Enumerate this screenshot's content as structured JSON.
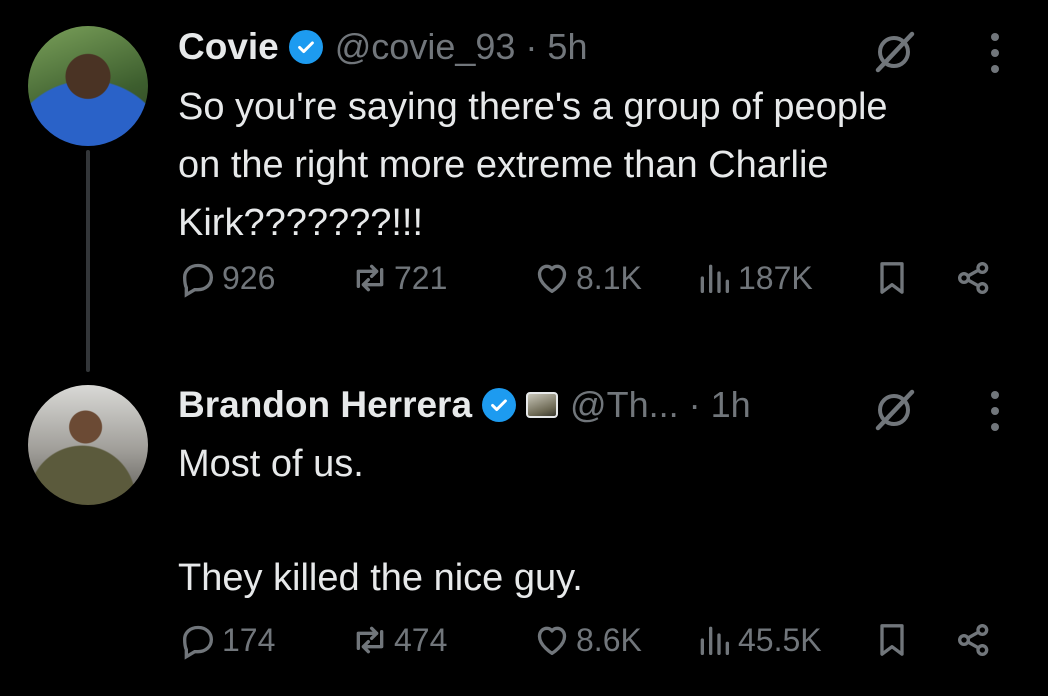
{
  "tweets": [
    {
      "name": "Covie",
      "handle": "@covie_93",
      "separator": "·",
      "time": "5h",
      "text": "So you're saying there's a group of people\non the right more extreme than Charlie\nKirk???????!!!",
      "stats": {
        "replies": "926",
        "reposts": "721",
        "likes": "8.1K",
        "views": "187K"
      }
    },
    {
      "name": "Brandon Herrera",
      "handle": "@Th...",
      "separator": "·",
      "time": "1h",
      "text": "Most of us.\n\nThey killed the nice guy.",
      "stats": {
        "replies": "174",
        "reposts": "474",
        "likes": "8.6K",
        "views": "45.5K"
      }
    }
  ],
  "colors": {
    "background": "#000000",
    "text": "#e7e9ea",
    "muted": "#71767b",
    "verified": "#1d9bf0",
    "thread_line": "#333639"
  },
  "icons": [
    "verified-badge-icon",
    "grok-icon",
    "more-icon",
    "reply-icon",
    "retweet-icon",
    "like-icon",
    "views-icon",
    "bookmark-icon",
    "share-icon"
  ]
}
